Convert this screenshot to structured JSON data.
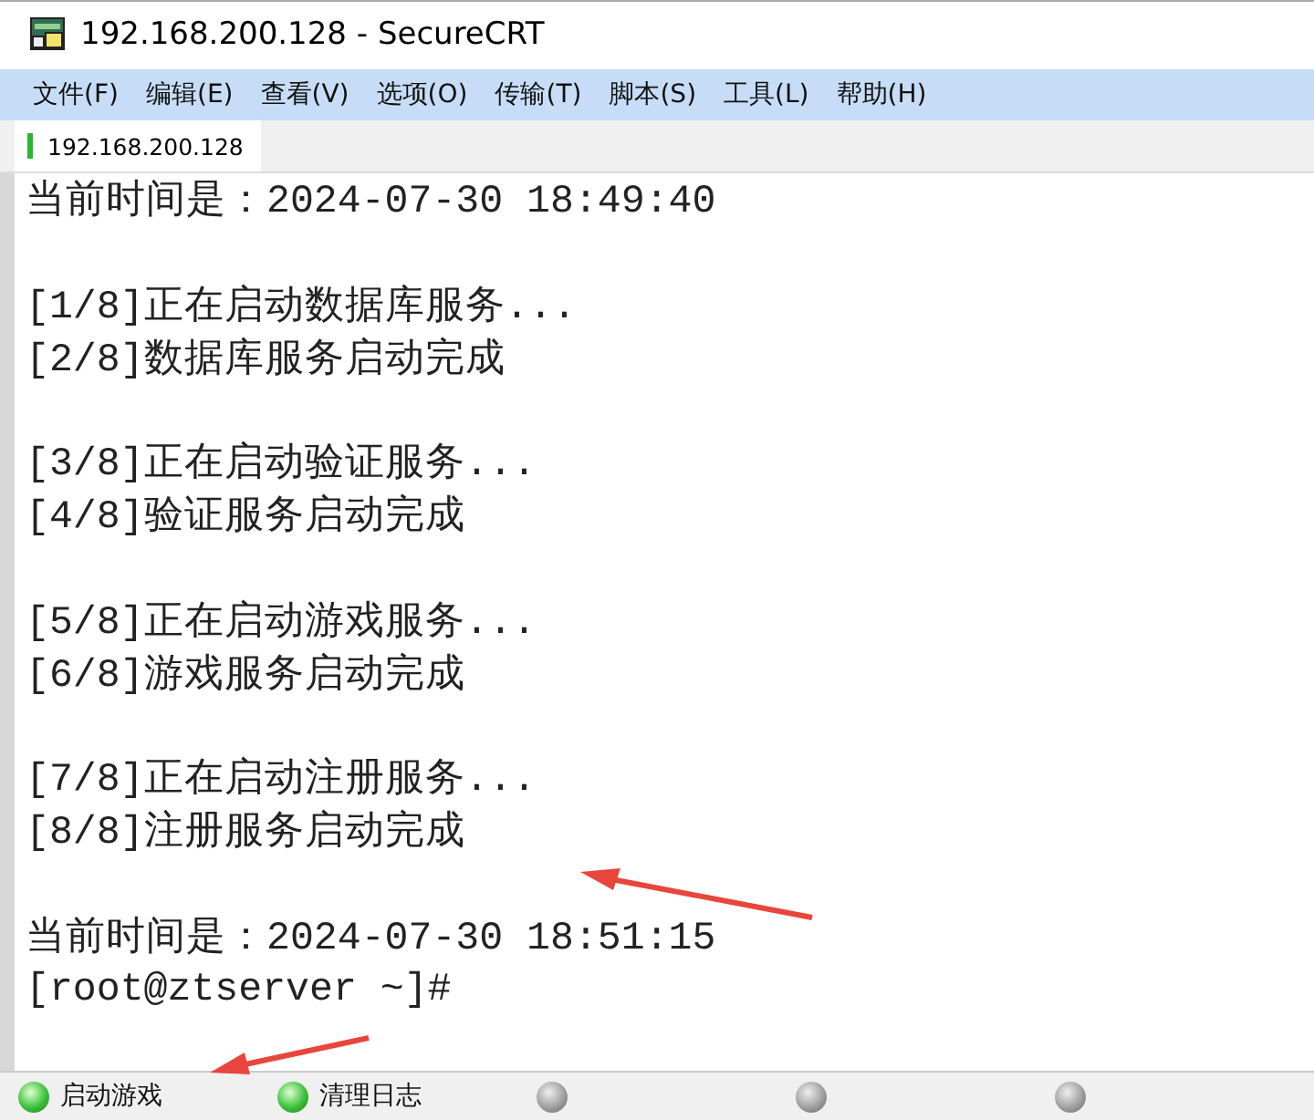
{
  "window": {
    "title": "192.168.200.128 - SecureCRT"
  },
  "menu": [
    "文件(F)",
    "编辑(E)",
    "查看(V)",
    "选项(O)",
    "传输(T)",
    "脚本(S)",
    "工具(L)",
    "帮助(H)"
  ],
  "tabs": [
    {
      "label": "192.168.200.128",
      "selected": true,
      "connected": true
    }
  ],
  "terminal": {
    "blocks": [
      [
        "当前时间是：2024-07-30 18:49:40"
      ],
      [
        "[1/8]正在启动数据库服务...",
        "[2/8]数据库服务启动完成"
      ],
      [
        "[3/8]正在启动验证服务...",
        "[4/8]验证服务启动完成"
      ],
      [
        "[5/8]正在启动游戏服务...",
        "[6/8]游戏服务启动完成"
      ],
      [
        "[7/8]正在启动注册服务...",
        "[8/8]注册服务启动完成"
      ],
      [
        "当前时间是：2024-07-30 18:51:15",
        "[root@ztserver ~]#"
      ]
    ]
  },
  "button_bar": [
    {
      "label": "启动游戏",
      "lit": true
    },
    {
      "label": "清理日志",
      "lit": true
    },
    {
      "lit": false
    },
    {
      "lit": false
    },
    {
      "lit": false
    }
  ]
}
